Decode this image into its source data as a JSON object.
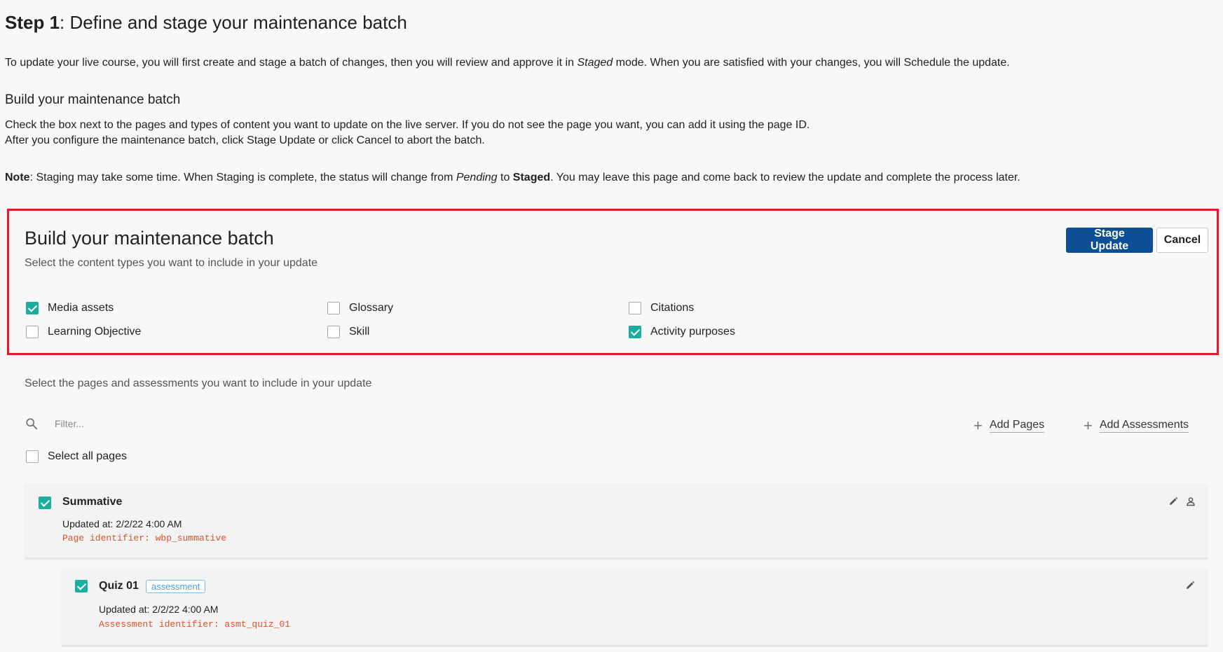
{
  "header": {
    "step_label": "Step 1",
    "step_title": ": Define and stage your maintenance batch",
    "intro_part1": "To update your live course, you will first create and stage a batch of changes, then you will review and approve it in ",
    "intro_em": "Staged",
    "intro_part2": " mode. When you are satisfied with your changes, you will Schedule the update."
  },
  "build_section": {
    "heading": "Build your maintenance batch",
    "line1": "Check the box next to the pages and types of content you want to update on the live server. If you do not see the page you want, you can add it using the page ID.",
    "line2": "After you configure the maintenance batch, click Stage Update or click Cancel to abort the batch."
  },
  "note": {
    "label": "Note",
    "part1": ": Staging may take some time. When Staging is complete, the status will change from ",
    "em": "Pending",
    "part2": " to ",
    "strong": "Staged",
    "part3": ". You may leave this page and come back to review the update and complete the process later."
  },
  "batch_panel": {
    "title": "Build your maintenance batch",
    "subtitle": "Select the content types you want to include in your update",
    "stage_update_label": "Stage Update",
    "cancel_label": "Cancel",
    "content_types": [
      {
        "label": "Media assets",
        "checked": true
      },
      {
        "label": "Glossary",
        "checked": false
      },
      {
        "label": "Citations",
        "checked": false
      },
      {
        "label": "Learning Objective",
        "checked": false
      },
      {
        "label": "Skill",
        "checked": false
      },
      {
        "label": "Activity purposes",
        "checked": true
      }
    ]
  },
  "pages_section": {
    "subtitle": "Select the pages and assessments you want to include in your update",
    "filter_placeholder": "Filter...",
    "add_pages_label": "Add Pages",
    "add_assessments_label": "Add Assessments",
    "select_all_label": "Select all pages",
    "select_all_checked": false
  },
  "items": [
    {
      "title": "Summative",
      "checked": true,
      "updated": "Updated at: 2/2/22 4:00 AM",
      "identifier": "Page identifier: wbp_summative",
      "badge": ""
    },
    {
      "title": "Quiz 01",
      "checked": true,
      "updated": "Updated at: 2/2/22 4:00 AM",
      "identifier": "Assessment identifier: asmt_quiz_01",
      "badge": "assessment"
    }
  ],
  "colors": {
    "primary_button": "#0d4f95",
    "checkbox_checked": "#1aae9f",
    "highlight_border": "#e11a2b",
    "identifier_text": "#d9542b",
    "badge_text": "#4a9fe0"
  },
  "icons": {
    "search": "search-icon",
    "plus": "plus-icon",
    "edit": "pencil-icon",
    "user": "user-icon"
  }
}
